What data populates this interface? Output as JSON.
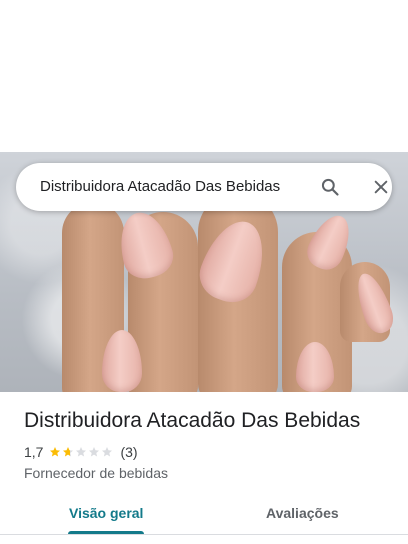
{
  "search": {
    "query": "Distribuidora Atacadão Das Bebidas",
    "search_icon": "search-icon",
    "close_icon": "close-icon"
  },
  "place": {
    "title": "Distribuidora Atacadão Das Bebidas",
    "rating": "1,7",
    "rating_value": 1.7,
    "rating_max": 5,
    "review_count": "(3)",
    "category": "Fornecedor de bebidas"
  },
  "tabs": [
    {
      "label": "Visão geral",
      "active": true
    },
    {
      "label": "Avaliações",
      "active": false
    }
  ],
  "colors": {
    "accent": "#137a8a",
    "star_filled": "#fbbc04",
    "star_empty": "#dadce0"
  }
}
